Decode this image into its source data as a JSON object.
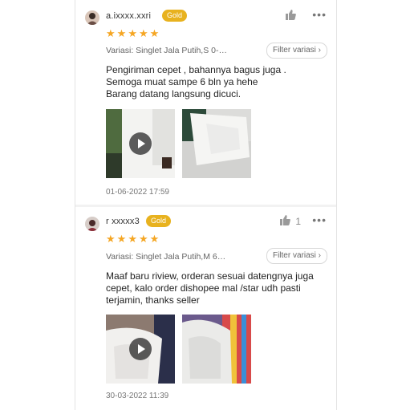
{
  "reviews": [
    {
      "username": "a.ixxxx.xxri",
      "badge": "Gold",
      "stars": 5,
      "like_count": "",
      "variant": "Variasi: Singlet Jala Putih,S 0-…",
      "filter_label": "Filter variasi",
      "text_lines": [
        "Pengiriman cepet , bahannya bagus juga .",
        "Semoga muat sampe 6 bln ya hehe",
        "Barang datang langsung dicuci."
      ],
      "date": "01-06-2022 17:59"
    },
    {
      "username": "r xxxxx3",
      "badge": "Gold",
      "stars": 5,
      "like_count": "1",
      "variant": "Variasi: Singlet Jala Putih,M 6…",
      "filter_label": "Filter variasi",
      "text_lines": [
        "Maaf baru riview, orderan sesuai datengnya juga",
        "cepet, kalo order dishopee mal /star udh pasti",
        "terjamin, thanks seller"
      ],
      "date": "30-03-2022 11:39"
    }
  ],
  "icons": {
    "thumb": "thumbs-up-icon",
    "more": "more-dots-icon",
    "play": "play-icon",
    "chevron": "chevron-right-icon"
  },
  "colors": {
    "gold_badge": "#e8b21f",
    "star": "#f5a623"
  }
}
